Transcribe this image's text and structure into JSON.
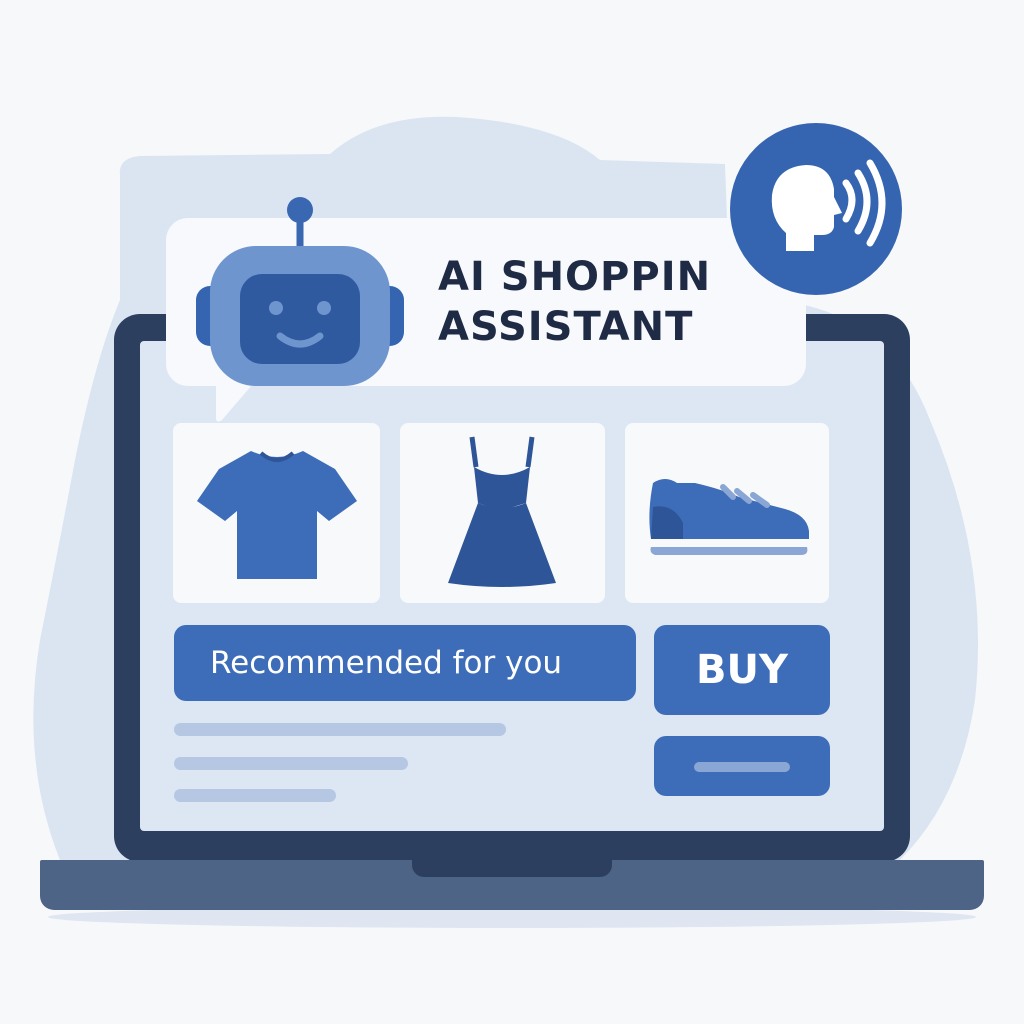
{
  "header": {
    "title_line1": "AI SHOPPIN",
    "title_line2": "ASSISTANT"
  },
  "icons": {
    "assistant": "robot-icon",
    "voice": "voice-speaking-head-icon",
    "products": [
      "tshirt-icon",
      "dress-icon",
      "sneaker-icon"
    ]
  },
  "actions": {
    "recommend_label": "Recommended for you",
    "buy_label": "BUY"
  },
  "colors": {
    "primary": "#3d6cb8",
    "dark": "#2d3f5f",
    "text": "#1f2b44",
    "screen_bg": "#dde6f3",
    "blob_bg": "#dbe5f2"
  }
}
